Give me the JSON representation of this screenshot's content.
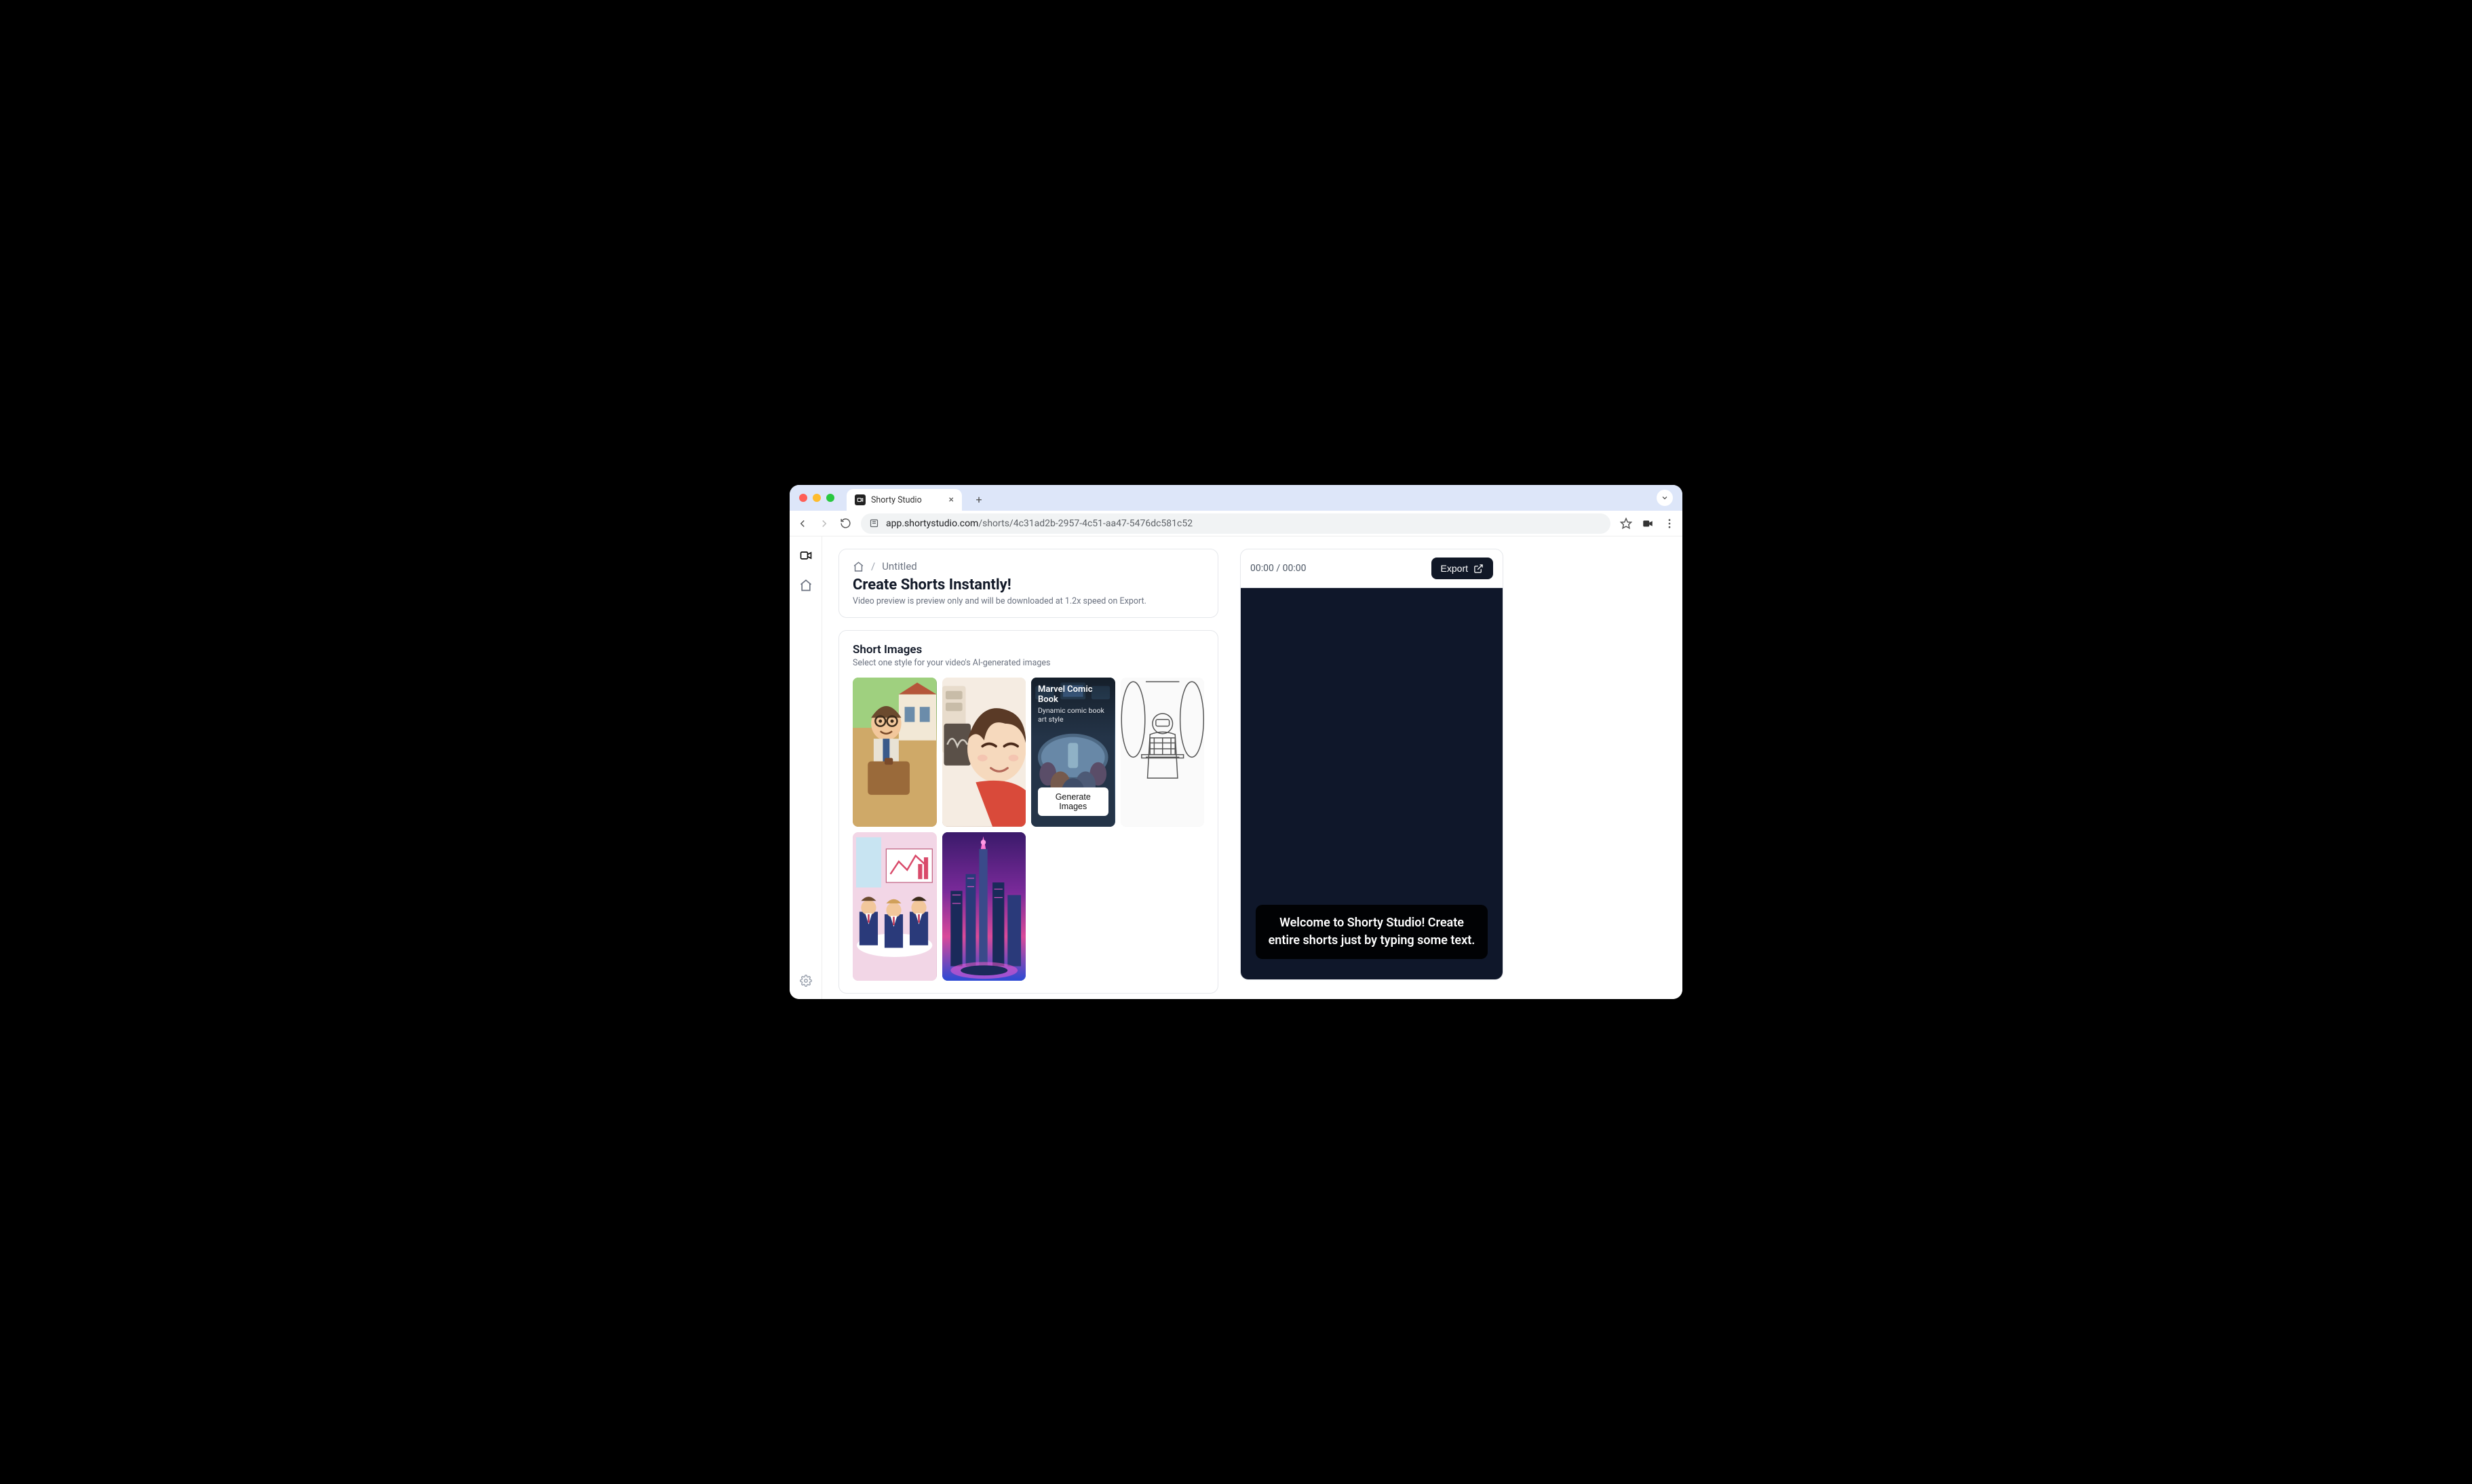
{
  "browser": {
    "tab_title": "Shorty Studio",
    "url_host": "app.shortystudio.com",
    "url_path": "/shorts/4c31ad2b-2957-4c51-aa47-5476dc581c52"
  },
  "breadcrumb": {
    "home_label": "Home",
    "title": "Untitled"
  },
  "header": {
    "heading": "Create Shorts Instantly!",
    "subtitle": "Video preview is preview only and will be downloaded at 1.2x speed on Export."
  },
  "images_section": {
    "title": "Short Images",
    "subtitle": "Select one style for your video's AI-generated images",
    "styles": [
      {
        "id": "pixar",
        "name": "",
        "desc": ""
      },
      {
        "id": "anime",
        "name": "",
        "desc": ""
      },
      {
        "id": "comic",
        "name": "Marvel Comic Book",
        "desc": "Dynamic comic book art style",
        "selected": true,
        "action": "Generate Images"
      },
      {
        "id": "sketch",
        "name": "",
        "desc": ""
      },
      {
        "id": "pixel",
        "name": "",
        "desc": ""
      },
      {
        "id": "neon",
        "name": "",
        "desc": ""
      }
    ]
  },
  "preview": {
    "timecode": "00:00 / 00:00",
    "export_label": "Export",
    "caption": "Welcome to Shorty Studio! Create entire shorts just by typing some text."
  }
}
